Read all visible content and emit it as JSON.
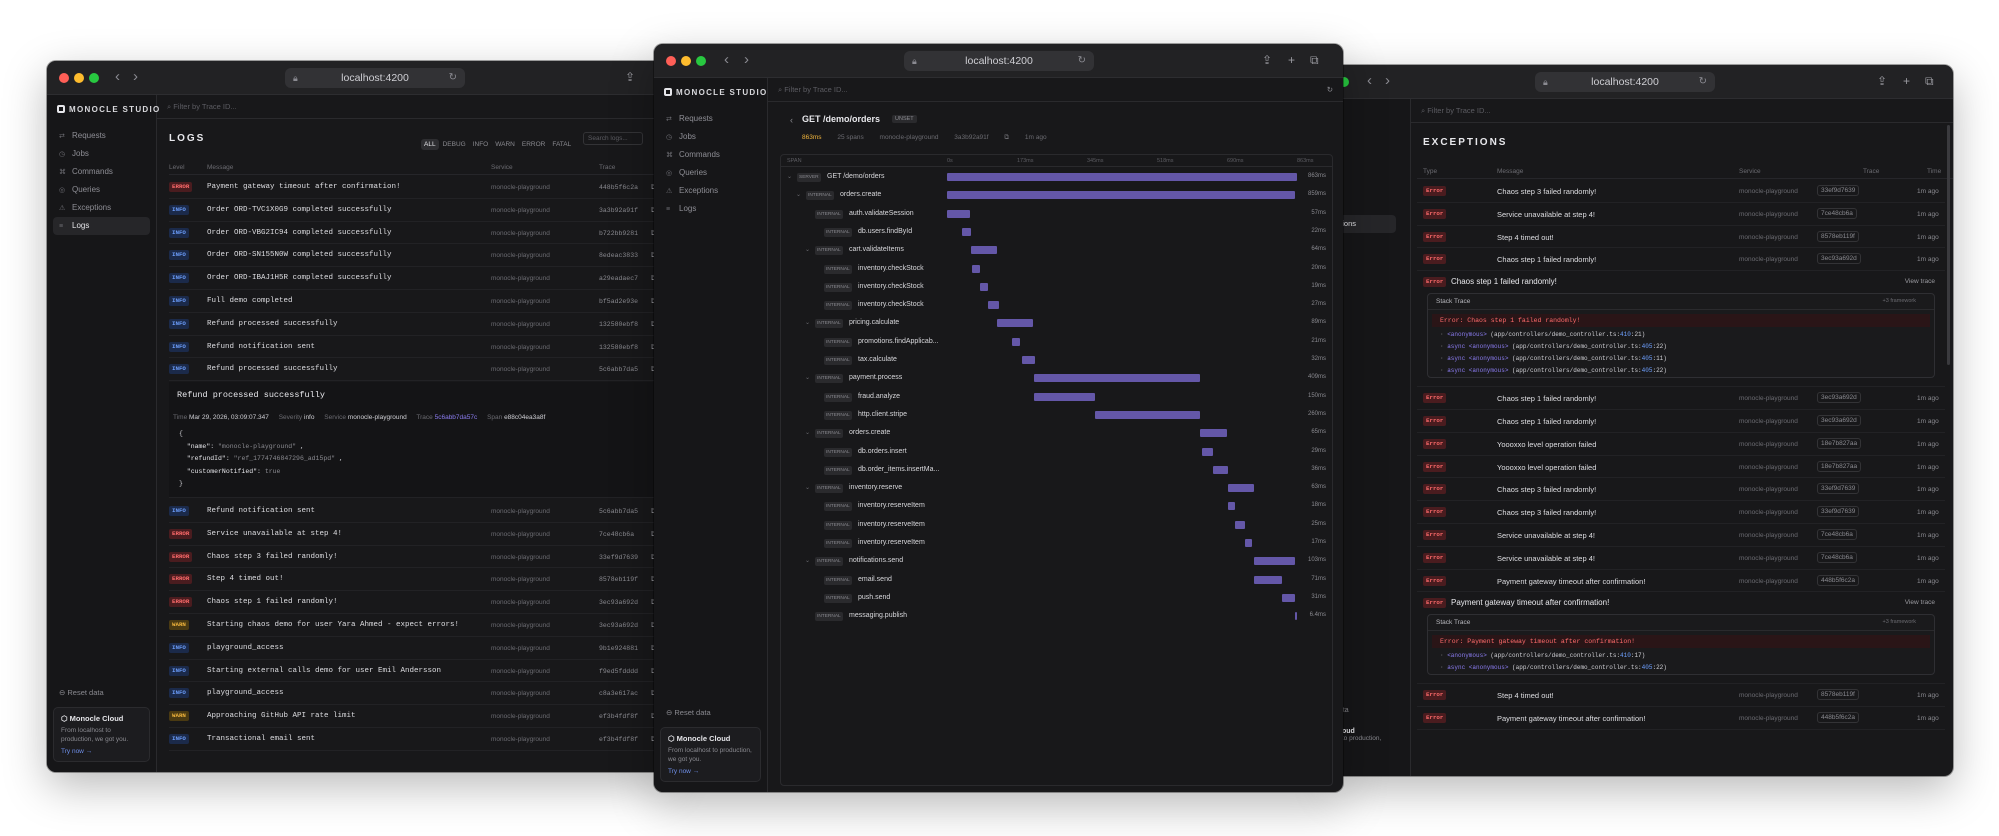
{
  "browser": {
    "url": "localhost:4200"
  },
  "brand": "MONOCLE STUDIO",
  "nav": [
    "Requests",
    "Jobs",
    "Commands",
    "Queries",
    "Exceptions",
    "Logs"
  ],
  "search_placeholder": "Filter by Trace ID...",
  "sidebar_bottom": {
    "reset": "Reset data",
    "cloud_title": "Monocle Cloud",
    "cloud_desc": "From localhost to production, we got you.",
    "cloud_link": "Try now →"
  },
  "logs": {
    "title": "LOGS",
    "levels": [
      "ALL",
      "DEBUG",
      "INFO",
      "WARN",
      "ERROR",
      "FATAL"
    ],
    "search_placeholder": "Search logs...",
    "columns": [
      "Level",
      "Message",
      "Service",
      "Trace"
    ],
    "rows_top": [
      {
        "level": "ERROR",
        "message": "Payment gateway timeout after confirmation!",
        "service": "monocle-playground",
        "trace": "448b5f6c2a"
      },
      {
        "level": "INFO",
        "message": "Order ORD-TVC1X0G9 completed successfully",
        "service": "monocle-playground",
        "trace": "3a3b92a91f"
      },
      {
        "level": "INFO",
        "message": "Order ORD-VBG2IC94 completed successfully",
        "service": "monocle-playground",
        "trace": "b722bb9281"
      },
      {
        "level": "INFO",
        "message": "Order ORD-SN155N0W completed successfully",
        "service": "monocle-playground",
        "trace": "8edeac3833"
      },
      {
        "level": "INFO",
        "message": "Order ORD-IBAJ1H5R completed successfully",
        "service": "monocle-playground",
        "trace": "a29eadaec7"
      },
      {
        "level": "INFO",
        "message": "Full demo completed",
        "service": "monocle-playground",
        "trace": "bf5ad2e93e"
      },
      {
        "level": "INFO",
        "message": "Refund processed successfully",
        "service": "monocle-playground",
        "trace": "132580ebf8"
      },
      {
        "level": "INFO",
        "message": "Refund notification sent",
        "service": "monocle-playground",
        "trace": "132580ebf8"
      },
      {
        "level": "INFO",
        "message": "Refund processed successfully",
        "service": "monocle-playground",
        "trace": "5c6abb7da5"
      }
    ],
    "expanded": {
      "title": "Refund processed successfully",
      "time_label": "Time",
      "time": "Mar 29, 2026, 03:09:07.347",
      "severity_label": "Severity",
      "severity": "info",
      "service_label": "Service",
      "service": "monocle-playground",
      "trace_label": "Trace",
      "trace": "5c6abb7da57c",
      "span_label": "Span",
      "span": "e88c04ea3a8f",
      "json": {
        "name": "\"monocle-playground\"",
        "refundId": "\"ref_1774746847296_ad15pd\"",
        "customerNotified": "true"
      }
    },
    "rows_bottom": [
      {
        "level": "INFO",
        "message": "Refund notification sent",
        "service": "monocle-playground",
        "trace": "5c6abb7da5"
      },
      {
        "level": "ERROR",
        "message": "Service unavailable at step 4!",
        "service": "monocle-playground",
        "trace": "7ce48cb6a"
      },
      {
        "level": "ERROR",
        "message": "Chaos step 3 failed randomly!",
        "service": "monocle-playground",
        "trace": "33ef9d7639"
      },
      {
        "level": "ERROR",
        "message": "Step 4 timed out!",
        "service": "monocle-playground",
        "trace": "8578eb119f"
      },
      {
        "level": "ERROR",
        "message": "Chaos step 1 failed randomly!",
        "service": "monocle-playground",
        "trace": "3ec93a692d"
      },
      {
        "level": "WARN",
        "message": "Starting chaos demo for user Yara Ahmed - expect errors!",
        "service": "monocle-playground",
        "trace": "3ec93a692d"
      },
      {
        "level": "INFO",
        "message": "playground_access",
        "service": "monocle-playground",
        "trace": "9b1e924881"
      },
      {
        "level": "INFO",
        "message": "Starting external calls demo for user Emil Andersson",
        "service": "monocle-playground",
        "trace": "f9ed5fdddd"
      },
      {
        "level": "INFO",
        "message": "playground_access",
        "service": "monocle-playground",
        "trace": "c8a3e617ac"
      },
      {
        "level": "WARN",
        "message": "Approaching GitHub API rate limit",
        "service": "monocle-playground",
        "trace": "ef3b4fdf8f"
      },
      {
        "level": "INFO",
        "message": "Transactional email sent",
        "service": "monocle-playground",
        "trace": "ef3b4fdf8f"
      }
    ]
  },
  "trace": {
    "title": "GET /demo/orders",
    "status_badge": "UNSET",
    "duration": "863ms",
    "spans": "25 spans",
    "service": "monocle-playground",
    "trace_id": "3a3b92a91f",
    "ago": "1m ago",
    "header_span": "SPAN",
    "ticks": [
      "0s",
      "173ms",
      "345ms",
      "518ms",
      "690ms",
      "863ms"
    ],
    "total_ms": 863,
    "rows": [
      {
        "kind": "SERVER",
        "name": "GET /demo/orders",
        "depth": 0,
        "start": 0,
        "dur": 863,
        "label": "863ms",
        "chev": true
      },
      {
        "kind": "INTERNAL",
        "name": "orders.create",
        "depth": 1,
        "start": 0,
        "dur": 859,
        "label": "859ms",
        "chev": true
      },
      {
        "kind": "INTERNAL",
        "name": "auth.validateSession",
        "depth": 2,
        "start": 0,
        "dur": 57,
        "label": "57ms"
      },
      {
        "kind": "INTERNAL",
        "name": "db.users.findById",
        "depth": 3,
        "start": 38,
        "dur": 22,
        "label": "22ms"
      },
      {
        "kind": "INTERNAL",
        "name": "cart.validateItems",
        "depth": 2,
        "start": 60,
        "dur": 64,
        "label": "64ms",
        "chev": true
      },
      {
        "kind": "INTERNAL",
        "name": "inventory.checkStock",
        "depth": 3,
        "start": 62,
        "dur": 20,
        "label": "20ms"
      },
      {
        "kind": "INTERNAL",
        "name": "inventory.checkStock",
        "depth": 3,
        "start": 82,
        "dur": 19,
        "label": "19ms"
      },
      {
        "kind": "INTERNAL",
        "name": "inventory.checkStock",
        "depth": 3,
        "start": 101,
        "dur": 27,
        "label": "27ms"
      },
      {
        "kind": "INTERNAL",
        "name": "pricing.calculate",
        "depth": 2,
        "start": 124,
        "dur": 89,
        "label": "89ms",
        "chev": true
      },
      {
        "kind": "INTERNAL",
        "name": "promotions.findApplicab...",
        "depth": 3,
        "start": 160,
        "dur": 21,
        "label": "21ms"
      },
      {
        "kind": "INTERNAL",
        "name": "tax.calculate",
        "depth": 3,
        "start": 185,
        "dur": 32,
        "label": "32ms"
      },
      {
        "kind": "INTERNAL",
        "name": "payment.process",
        "depth": 2,
        "start": 215,
        "dur": 409,
        "label": "409ms",
        "chev": true
      },
      {
        "kind": "INTERNAL",
        "name": "fraud.analyze",
        "depth": 3,
        "start": 215,
        "dur": 150,
        "label": "150ms"
      },
      {
        "kind": "INTERNAL",
        "name": "http.client.stripe",
        "depth": 3,
        "start": 365,
        "dur": 260,
        "label": "260ms"
      },
      {
        "kind": "INTERNAL",
        "name": "orders.create",
        "depth": 2,
        "start": 625,
        "dur": 65,
        "label": "65ms",
        "chev": true
      },
      {
        "kind": "INTERNAL",
        "name": "db.orders.insert",
        "depth": 3,
        "start": 628,
        "dur": 29,
        "label": "29ms"
      },
      {
        "kind": "INTERNAL",
        "name": "db.order_items.insertMa...",
        "depth": 3,
        "start": 657,
        "dur": 36,
        "label": "36ms"
      },
      {
        "kind": "INTERNAL",
        "name": "inventory.reserve",
        "depth": 2,
        "start": 693,
        "dur": 63,
        "label": "63ms",
        "chev": true
      },
      {
        "kind": "INTERNAL",
        "name": "inventory.reserveItem",
        "depth": 3,
        "start": 693,
        "dur": 18,
        "label": "18ms"
      },
      {
        "kind": "INTERNAL",
        "name": "inventory.reserveItem",
        "depth": 3,
        "start": 711,
        "dur": 25,
        "label": "25ms"
      },
      {
        "kind": "INTERNAL",
        "name": "inventory.reserveItem",
        "depth": 3,
        "start": 736,
        "dur": 17,
        "label": "17ms"
      },
      {
        "kind": "INTERNAL",
        "name": "notifications.send",
        "depth": 2,
        "start": 756,
        "dur": 103,
        "label": "103ms",
        "chev": true
      },
      {
        "kind": "INTERNAL",
        "name": "email.send",
        "depth": 3,
        "start": 756,
        "dur": 71,
        "label": "71ms"
      },
      {
        "kind": "INTERNAL",
        "name": "push.send",
        "depth": 3,
        "start": 827,
        "dur": 31,
        "label": "31ms"
      },
      {
        "kind": "INTERNAL",
        "name": "messaging.publish",
        "depth": 2,
        "start": 858,
        "dur": 5,
        "label": "6.4ms"
      }
    ]
  },
  "exceptions": {
    "title": "EXCEPTIONS",
    "columns": [
      "Type",
      "Message",
      "Service",
      "Trace",
      "Time"
    ],
    "side_partial": [
      "ands",
      "s",
      "ptions"
    ],
    "side_bottom": [
      "data",
      "Cloud",
      "st to production,"
    ],
    "rows_a": [
      {
        "type": "Error",
        "message": "Chaos step 3 failed randomly!",
        "service": "monocle-playground",
        "trace": "33ef9d7639",
        "ago": "1m ago"
      },
      {
        "type": "Error",
        "message": "Service unavailable at step 4!",
        "service": "monocle-playground",
        "trace": "7ce48cb6a",
        "ago": "1m ago"
      },
      {
        "type": "Error",
        "message": "Step 4 timed out!",
        "service": "monocle-playground",
        "trace": "8578eb119f",
        "ago": "1m ago"
      },
      {
        "type": "Error",
        "message": "Chaos step 1 failed randomly!",
        "service": "monocle-playground",
        "trace": "3ec93a692d",
        "ago": "1m ago"
      }
    ],
    "open1": {
      "type": "Error",
      "title": "Chaos step 1 failed randomly!",
      "view": "View trace",
      "stack_title": "Stack Trace",
      "framework": "+3 framework",
      "error": "Error: Chaos step 1 failed randomly!",
      "frames": [
        {
          "fn": "<anonymous>",
          "file": "(app/controllers/demo_controller.ts:",
          "line": "410",
          "col": ":21)"
        },
        {
          "fn": "async <anonymous>",
          "file": "(app/controllers/demo_controller.ts:",
          "line": "405",
          "col": ":22)"
        },
        {
          "fn": "async <anonymous>",
          "file": "(app/controllers/demo_controller.ts:",
          "line": "405",
          "col": ":11)"
        },
        {
          "fn": "async <anonymous>",
          "file": "(app/controllers/demo_controller.ts:",
          "line": "405",
          "col": ":22)"
        }
      ]
    },
    "rows_b": [
      {
        "type": "Error",
        "message": "Chaos step 1 failed randomly!",
        "service": "monocle-playground",
        "trace": "3ec93a692d",
        "ago": "1m ago"
      },
      {
        "type": "Error",
        "message": "Chaos step 1 failed randomly!",
        "service": "monocle-playground",
        "trace": "3ec93a692d",
        "ago": "1m ago"
      },
      {
        "type": "Error",
        "message": "Yoooxxo level operation failed",
        "service": "monocle-playground",
        "trace": "18e7b827aa",
        "ago": "1m ago"
      },
      {
        "type": "Error",
        "message": "Yoooxxo level operation failed",
        "service": "monocle-playground",
        "trace": "18e7b827aa",
        "ago": "1m ago"
      },
      {
        "type": "Error",
        "message": "Chaos step 3 failed randomly!",
        "service": "monocle-playground",
        "trace": "33ef9d7639",
        "ago": "1m ago"
      },
      {
        "type": "Error",
        "message": "Chaos step 3 failed randomly!",
        "service": "monocle-playground",
        "trace": "33ef9d7639",
        "ago": "1m ago"
      },
      {
        "type": "Error",
        "message": "Service unavailable at step 4!",
        "service": "monocle-playground",
        "trace": "7ce48cb6a",
        "ago": "1m ago"
      },
      {
        "type": "Error",
        "message": "Service unavailable at step 4!",
        "service": "monocle-playground",
        "trace": "7ce48cb6a",
        "ago": "1m ago"
      },
      {
        "type": "Error",
        "message": "Payment gateway timeout after confirmation!",
        "service": "monocle-playground",
        "trace": "448b5f6c2a",
        "ago": "1m ago"
      }
    ],
    "open2": {
      "type": "Error",
      "title": "Payment gateway timeout after confirmation!",
      "view": "View trace",
      "stack_title": "Stack Trace",
      "framework": "+3 framework",
      "error": "Error: Payment gateway timeout after confirmation!",
      "frames": [
        {
          "fn": "<anonymous>",
          "file": "(app/controllers/demo_controller.ts:",
          "line": "410",
          "col": ":17)"
        },
        {
          "fn": "async <anonymous>",
          "file": "(app/controllers/demo_controller.ts:",
          "line": "405",
          "col": ":22)"
        }
      ]
    },
    "rows_c": [
      {
        "type": "Error",
        "message": "Step 4 timed out!",
        "service": "monocle-playground",
        "trace": "8578eb119f",
        "ago": "1m ago"
      },
      {
        "type": "Error",
        "message": "Payment gateway timeout after confirmation!",
        "service": "monocle-playground",
        "trace": "448b5f6c2a",
        "ago": "1m ago"
      }
    ]
  }
}
